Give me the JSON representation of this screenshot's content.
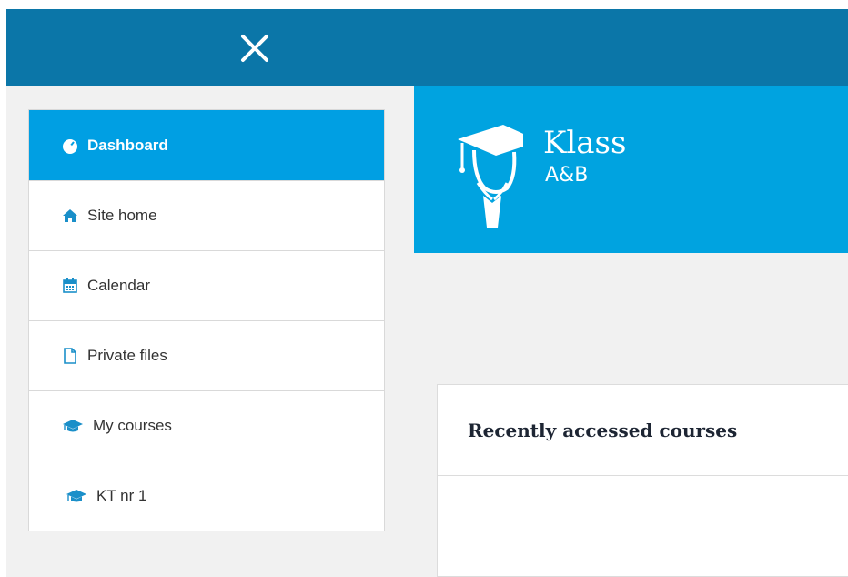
{
  "topbar": {
    "close_icon": "close-icon"
  },
  "nav": {
    "items": [
      {
        "label": "Dashboard",
        "icon": "dashboard-icon",
        "active": true
      },
      {
        "label": "Site home",
        "icon": "home-icon"
      },
      {
        "label": "Calendar",
        "icon": "calendar-icon"
      },
      {
        "label": "Private files",
        "icon": "file-icon"
      },
      {
        "label": "My courses",
        "icon": "graduation-cap-icon"
      },
      {
        "label": "KT nr 1",
        "icon": "graduation-cap-icon"
      }
    ]
  },
  "brand": {
    "name": "Klass",
    "subtitle": "A&B",
    "logo_icon": "graduate-logo"
  },
  "card": {
    "title": "Recently accessed courses"
  },
  "colors": {
    "topbar": "#0b76a8",
    "accent": "#009fe3",
    "brand_bg": "#00a3e0",
    "icon_blue": "#1a8fc9"
  }
}
